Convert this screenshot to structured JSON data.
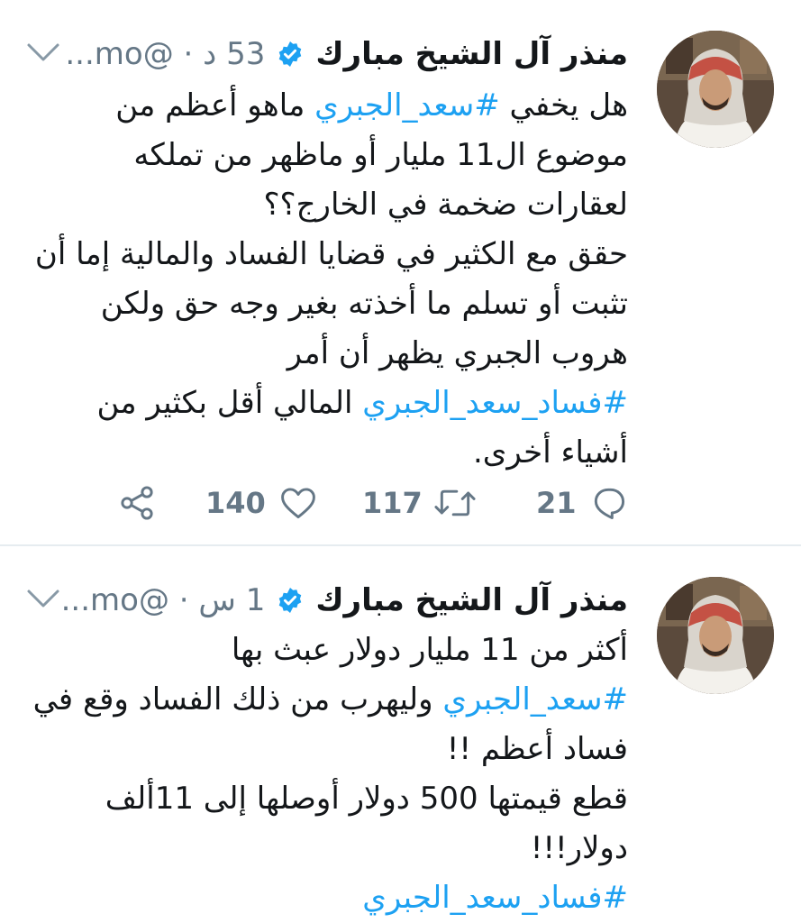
{
  "colors": {
    "link": "#1da1f2",
    "text": "#14171a",
    "muted": "#657786",
    "divider": "#e6ecf0",
    "verified": "#1da1f2"
  },
  "tweets": [
    {
      "author_name": "منذر آل الشيخ مبارك",
      "handle": "@mo...",
      "separator": "·",
      "time": "53 د",
      "verified_icon": "verified-badge-icon",
      "avatar": "profile-photo",
      "lines": [
        {
          "segments": [
            {
              "text": "هل يخفي ",
              "hashtag": false
            },
            {
              "text": "#سعد_الجبري",
              "hashtag": true
            },
            {
              "text": " ماهو أعظم من",
              "hashtag": false
            }
          ]
        },
        {
          "segments": [
            {
              "text": "موضوع ال11 مليار أو ماظهر من تملكه",
              "hashtag": false
            }
          ]
        },
        {
          "segments": [
            {
              "text": "لعقارات ضخمة في الخارج؟؟",
              "hashtag": false
            }
          ]
        },
        {
          "segments": [
            {
              "text": "حقق مع الكثير في قضايا الفساد والمالية إما أن",
              "hashtag": false
            }
          ]
        },
        {
          "segments": [
            {
              "text": "تثبت أو تسلم ما أخذته بغير وجه حق ولكن",
              "hashtag": false
            }
          ]
        },
        {
          "segments": [
            {
              "text": "هروب الجبري يظهر أن أمر",
              "hashtag": false
            }
          ]
        },
        {
          "segments": [
            {
              "text": "#فساد_سعد_الجبري",
              "hashtag": true
            },
            {
              "text": " المالي أقل بكثير من",
              "hashtag": false
            }
          ]
        },
        {
          "segments": [
            {
              "text": "أشياء أخرى.",
              "hashtag": false
            }
          ]
        }
      ],
      "actions": {
        "reply_count": "21",
        "retweet_count": "117",
        "like_count": "140"
      }
    },
    {
      "author_name": "منذر آل الشيخ مبارك",
      "handle": "@mo...",
      "separator": "·",
      "time": "1 س",
      "verified_icon": "verified-badge-icon",
      "avatar": "profile-photo",
      "lines": [
        {
          "segments": [
            {
              "text": "أكثر من 11 مليار دولار عبث بها",
              "hashtag": false
            }
          ]
        },
        {
          "segments": [
            {
              "text": "#سعد_الجبري",
              "hashtag": true
            },
            {
              "text": " وليهرب من ذلك الفساد وقع في",
              "hashtag": false
            }
          ]
        },
        {
          "segments": [
            {
              "text": "فساد أعظم !!",
              "hashtag": false
            }
          ]
        },
        {
          "segments": [
            {
              "text": "قطع قيمتها 500 دولار أوصلها إلى 11ألف",
              "hashtag": false
            }
          ]
        },
        {
          "segments": [
            {
              "text": "دولار!!!",
              "hashtag": false
            }
          ]
        },
        {
          "segments": [
            {
              "text": "#فساد_سعد_الجبري",
              "hashtag": true
            }
          ]
        }
      ]
    }
  ]
}
